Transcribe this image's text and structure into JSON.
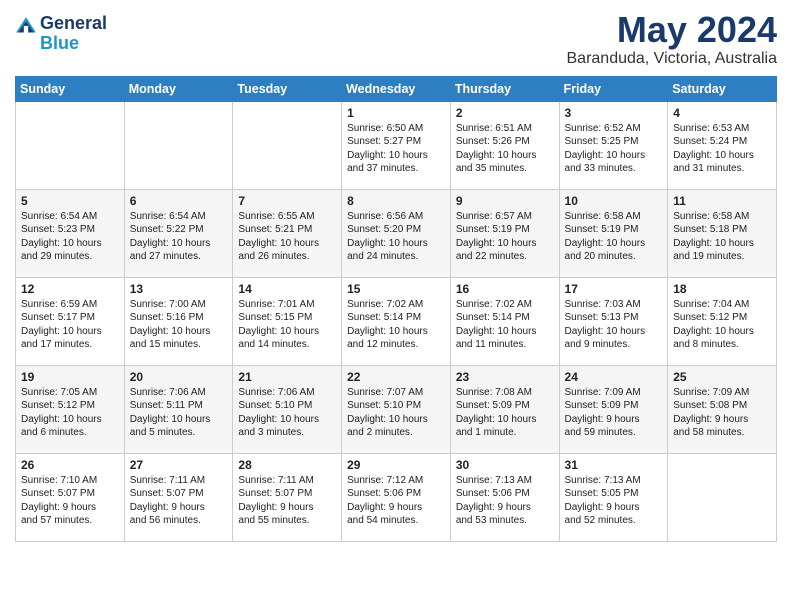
{
  "logo": {
    "line1": "General",
    "line2": "Blue"
  },
  "title": "May 2024",
  "subtitle": "Baranduda, Victoria, Australia",
  "header_days": [
    "Sunday",
    "Monday",
    "Tuesday",
    "Wednesday",
    "Thursday",
    "Friday",
    "Saturday"
  ],
  "weeks": [
    [
      {
        "num": "",
        "info": ""
      },
      {
        "num": "",
        "info": ""
      },
      {
        "num": "",
        "info": ""
      },
      {
        "num": "1",
        "info": "Sunrise: 6:50 AM\nSunset: 5:27 PM\nDaylight: 10 hours\nand 37 minutes."
      },
      {
        "num": "2",
        "info": "Sunrise: 6:51 AM\nSunset: 5:26 PM\nDaylight: 10 hours\nand 35 minutes."
      },
      {
        "num": "3",
        "info": "Sunrise: 6:52 AM\nSunset: 5:25 PM\nDaylight: 10 hours\nand 33 minutes."
      },
      {
        "num": "4",
        "info": "Sunrise: 6:53 AM\nSunset: 5:24 PM\nDaylight: 10 hours\nand 31 minutes."
      }
    ],
    [
      {
        "num": "5",
        "info": "Sunrise: 6:54 AM\nSunset: 5:23 PM\nDaylight: 10 hours\nand 29 minutes."
      },
      {
        "num": "6",
        "info": "Sunrise: 6:54 AM\nSunset: 5:22 PM\nDaylight: 10 hours\nand 27 minutes."
      },
      {
        "num": "7",
        "info": "Sunrise: 6:55 AM\nSunset: 5:21 PM\nDaylight: 10 hours\nand 26 minutes."
      },
      {
        "num": "8",
        "info": "Sunrise: 6:56 AM\nSunset: 5:20 PM\nDaylight: 10 hours\nand 24 minutes."
      },
      {
        "num": "9",
        "info": "Sunrise: 6:57 AM\nSunset: 5:19 PM\nDaylight: 10 hours\nand 22 minutes."
      },
      {
        "num": "10",
        "info": "Sunrise: 6:58 AM\nSunset: 5:19 PM\nDaylight: 10 hours\nand 20 minutes."
      },
      {
        "num": "11",
        "info": "Sunrise: 6:58 AM\nSunset: 5:18 PM\nDaylight: 10 hours\nand 19 minutes."
      }
    ],
    [
      {
        "num": "12",
        "info": "Sunrise: 6:59 AM\nSunset: 5:17 PM\nDaylight: 10 hours\nand 17 minutes."
      },
      {
        "num": "13",
        "info": "Sunrise: 7:00 AM\nSunset: 5:16 PM\nDaylight: 10 hours\nand 15 minutes."
      },
      {
        "num": "14",
        "info": "Sunrise: 7:01 AM\nSunset: 5:15 PM\nDaylight: 10 hours\nand 14 minutes."
      },
      {
        "num": "15",
        "info": "Sunrise: 7:02 AM\nSunset: 5:14 PM\nDaylight: 10 hours\nand 12 minutes."
      },
      {
        "num": "16",
        "info": "Sunrise: 7:02 AM\nSunset: 5:14 PM\nDaylight: 10 hours\nand 11 minutes."
      },
      {
        "num": "17",
        "info": "Sunrise: 7:03 AM\nSunset: 5:13 PM\nDaylight: 10 hours\nand 9 minutes."
      },
      {
        "num": "18",
        "info": "Sunrise: 7:04 AM\nSunset: 5:12 PM\nDaylight: 10 hours\nand 8 minutes."
      }
    ],
    [
      {
        "num": "19",
        "info": "Sunrise: 7:05 AM\nSunset: 5:12 PM\nDaylight: 10 hours\nand 6 minutes."
      },
      {
        "num": "20",
        "info": "Sunrise: 7:06 AM\nSunset: 5:11 PM\nDaylight: 10 hours\nand 5 minutes."
      },
      {
        "num": "21",
        "info": "Sunrise: 7:06 AM\nSunset: 5:10 PM\nDaylight: 10 hours\nand 3 minutes."
      },
      {
        "num": "22",
        "info": "Sunrise: 7:07 AM\nSunset: 5:10 PM\nDaylight: 10 hours\nand 2 minutes."
      },
      {
        "num": "23",
        "info": "Sunrise: 7:08 AM\nSunset: 5:09 PM\nDaylight: 10 hours\nand 1 minute."
      },
      {
        "num": "24",
        "info": "Sunrise: 7:09 AM\nSunset: 5:09 PM\nDaylight: 9 hours\nand 59 minutes."
      },
      {
        "num": "25",
        "info": "Sunrise: 7:09 AM\nSunset: 5:08 PM\nDaylight: 9 hours\nand 58 minutes."
      }
    ],
    [
      {
        "num": "26",
        "info": "Sunrise: 7:10 AM\nSunset: 5:07 PM\nDaylight: 9 hours\nand 57 minutes."
      },
      {
        "num": "27",
        "info": "Sunrise: 7:11 AM\nSunset: 5:07 PM\nDaylight: 9 hours\nand 56 minutes."
      },
      {
        "num": "28",
        "info": "Sunrise: 7:11 AM\nSunset: 5:07 PM\nDaylight: 9 hours\nand 55 minutes."
      },
      {
        "num": "29",
        "info": "Sunrise: 7:12 AM\nSunset: 5:06 PM\nDaylight: 9 hours\nand 54 minutes."
      },
      {
        "num": "30",
        "info": "Sunrise: 7:13 AM\nSunset: 5:06 PM\nDaylight: 9 hours\nand 53 minutes."
      },
      {
        "num": "31",
        "info": "Sunrise: 7:13 AM\nSunset: 5:05 PM\nDaylight: 9 hours\nand 52 minutes."
      },
      {
        "num": "",
        "info": ""
      }
    ]
  ]
}
